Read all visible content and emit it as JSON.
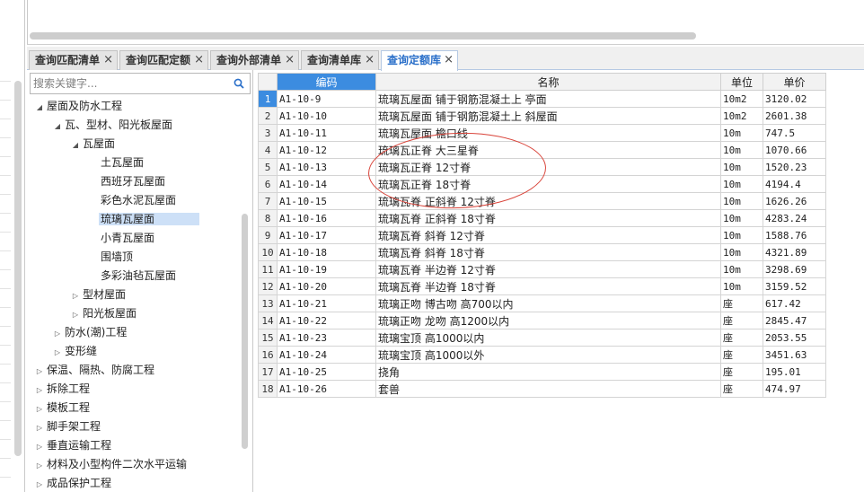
{
  "tabs": [
    {
      "label": "查询匹配清单",
      "close": "×",
      "active": false
    },
    {
      "label": "查询匹配定额",
      "close": "×",
      "active": false
    },
    {
      "label": "查询外部清单",
      "close": "×",
      "active": false
    },
    {
      "label": "查询清单库",
      "close": "×",
      "active": false
    },
    {
      "label": "查询定额库",
      "close": "×",
      "active": true
    }
  ],
  "search": {
    "placeholder": "搜索关键字..."
  },
  "tree": [
    {
      "label": "屋面及防水工程",
      "level": 0,
      "expander": "expanded"
    },
    {
      "label": "瓦、型材、阳光板屋面",
      "level": 1,
      "expander": "expanded"
    },
    {
      "label": "瓦屋面",
      "level": 2,
      "expander": "expanded"
    },
    {
      "label": "土瓦屋面",
      "level": 3,
      "expander": "none"
    },
    {
      "label": "西班牙瓦屋面",
      "level": 3,
      "expander": "none"
    },
    {
      "label": "彩色水泥瓦屋面",
      "level": 3,
      "expander": "none"
    },
    {
      "label": "琉璃瓦屋面",
      "level": 3,
      "expander": "none",
      "selected": true
    },
    {
      "label": "小青瓦屋面",
      "level": 3,
      "expander": "none"
    },
    {
      "label": "围墙顶",
      "level": 3,
      "expander": "none"
    },
    {
      "label": "多彩油毡瓦屋面",
      "level": 3,
      "expander": "none"
    },
    {
      "label": "型材屋面",
      "level": 2,
      "expander": "collapsed"
    },
    {
      "label": "阳光板屋面",
      "level": 2,
      "expander": "collapsed"
    },
    {
      "label": "防水(潮)工程",
      "level": 1,
      "expander": "collapsed"
    },
    {
      "label": "变形缝",
      "level": 1,
      "expander": "collapsed"
    },
    {
      "label": "保温、隔热、防腐工程",
      "level": 0,
      "expander": "collapsed"
    },
    {
      "label": "拆除工程",
      "level": 0,
      "expander": "collapsed"
    },
    {
      "label": "模板工程",
      "level": 0,
      "expander": "collapsed"
    },
    {
      "label": "脚手架工程",
      "level": 0,
      "expander": "collapsed"
    },
    {
      "label": "垂直运输工程",
      "level": 0,
      "expander": "collapsed"
    },
    {
      "label": "材料及小型构件二次水平运输",
      "level": 0,
      "expander": "collapsed"
    },
    {
      "label": "成品保护工程",
      "level": 0,
      "expander": "collapsed"
    }
  ],
  "grid": {
    "headers": {
      "code": "编码",
      "name": "名称",
      "unit": "单位",
      "price": "单价"
    },
    "rows": [
      {
        "idx": "1",
        "code": "A1-10-9",
        "name": "琉璃瓦屋面 铺于钢筋混凝土上 亭面",
        "unit": "10m2",
        "price": "3120.02"
      },
      {
        "idx": "2",
        "code": "A1-10-10",
        "name": "琉璃瓦屋面 铺于钢筋混凝土上 斜屋面",
        "unit": "10m2",
        "price": "2601.38"
      },
      {
        "idx": "3",
        "code": "A1-10-11",
        "name": "琉璃瓦屋面 檐口线",
        "unit": "10m",
        "price": "747.5"
      },
      {
        "idx": "4",
        "code": "A1-10-12",
        "name": "琉璃瓦正脊 大三星脊",
        "unit": "10m",
        "price": "1070.66"
      },
      {
        "idx": "5",
        "code": "A1-10-13",
        "name": "琉璃瓦正脊 12寸脊",
        "unit": "10m",
        "price": "1520.23"
      },
      {
        "idx": "6",
        "code": "A1-10-14",
        "name": "琉璃瓦正脊 18寸脊",
        "unit": "10m",
        "price": "4194.4"
      },
      {
        "idx": "7",
        "code": "A1-10-15",
        "name": "琉璃瓦脊 正斜脊 12寸脊",
        "unit": "10m",
        "price": "1626.26"
      },
      {
        "idx": "8",
        "code": "A1-10-16",
        "name": "琉璃瓦脊 正斜脊 18寸脊",
        "unit": "10m",
        "price": "4283.24"
      },
      {
        "idx": "9",
        "code": "A1-10-17",
        "name": "琉璃瓦脊 斜脊 12寸脊",
        "unit": "10m",
        "price": "1588.76"
      },
      {
        "idx": "10",
        "code": "A1-10-18",
        "name": "琉璃瓦脊 斜脊 18寸脊",
        "unit": "10m",
        "price": "4321.89"
      },
      {
        "idx": "11",
        "code": "A1-10-19",
        "name": "琉璃瓦脊 半边脊 12寸脊",
        "unit": "10m",
        "price": "3298.69"
      },
      {
        "idx": "12",
        "code": "A1-10-20",
        "name": "琉璃瓦脊 半边脊 18寸脊",
        "unit": "10m",
        "price": "3159.52"
      },
      {
        "idx": "13",
        "code": "A1-10-21",
        "name": "琉璃正吻 博古吻 高700以内",
        "unit": "座",
        "price": "617.42"
      },
      {
        "idx": "14",
        "code": "A1-10-22",
        "name": "琉璃正吻 龙吻 高1200以内",
        "unit": "座",
        "price": "2845.47"
      },
      {
        "idx": "15",
        "code": "A1-10-23",
        "name": "琉璃宝顶 高1000以内",
        "unit": "座",
        "price": "2053.55"
      },
      {
        "idx": "16",
        "code": "A1-10-24",
        "name": "琉璃宝顶 高1000以外",
        "unit": "座",
        "price": "3451.63"
      },
      {
        "idx": "17",
        "code": "A1-10-25",
        "name": "挠角",
        "unit": "座",
        "price": "195.01"
      },
      {
        "idx": "18",
        "code": "A1-10-26",
        "name": "套兽",
        "unit": "座",
        "price": "474.97"
      }
    ]
  },
  "colors": {
    "accent": "#3c8ce0",
    "selection": "#cde0f7",
    "annotation": "#d9443a"
  }
}
